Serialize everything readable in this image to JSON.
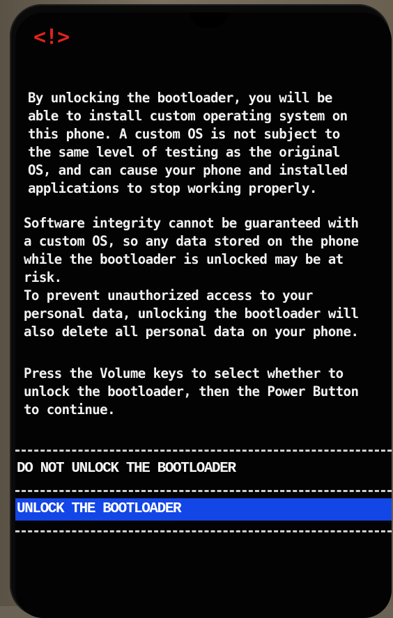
{
  "warning_icon": {
    "name": "warning-icon",
    "glyph": "<!>",
    "color": "#e0231c"
  },
  "paragraphs": {
    "intro": [
      "By unlocking the bootloader, you will be",
      "able to install custom operating system on",
      "this phone. A custom OS is not subject to",
      "the same level of testing as the original",
      "OS, and can cause your phone and installed",
      "applications to stop working properly."
    ],
    "integrity": [
      "Software integrity cannot be guaranteed with",
      "a custom OS, so any data stored on the phone",
      "while the bootloader is unlocked may be at",
      "risk."
    ],
    "data_delete": [
      "To prevent unauthorized access to your",
      "personal data, unlocking the bootloader will",
      "also delete all personal data on your phone."
    ],
    "instructions": [
      "Press the Volume keys to select whether to",
      "unlock the bootloader, then the Power Button",
      "to continue."
    ]
  },
  "options": [
    {
      "label": "DO NOT UNLOCK THE BOOTLOADER",
      "selected": false
    },
    {
      "label": "UNLOCK THE BOOTLOADER",
      "selected": true
    }
  ],
  "colors": {
    "selection": "#1346e6",
    "text": "#f2f2f2",
    "background": "#030303"
  }
}
